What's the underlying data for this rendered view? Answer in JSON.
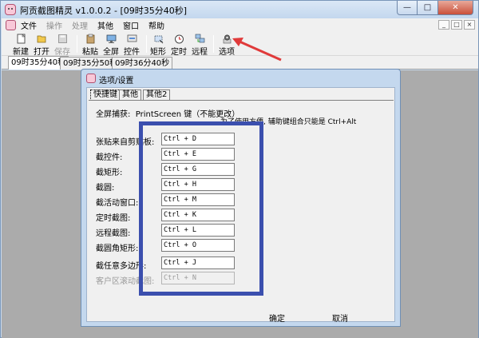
{
  "window": {
    "title": "阿贡截图精灵 v1.0.0.2 - [09时35分40秒]"
  },
  "menu": [
    {
      "label": "文件",
      "disabled": false
    },
    {
      "label": "操作",
      "disabled": true
    },
    {
      "label": "处理",
      "disabled": true
    },
    {
      "label": "其他",
      "disabled": false
    },
    {
      "label": "窗口",
      "disabled": false
    },
    {
      "label": "帮助",
      "disabled": false
    }
  ],
  "toolbar": {
    "new": "新建",
    "open": "打开",
    "save": "保存",
    "paste": "粘贴",
    "fullscreen": "全屏",
    "control": "控件",
    "rect": "矩形",
    "timer": "定时",
    "remote": "远程",
    "options": "选项"
  },
  "tabs": [
    "09时35分40秒",
    "09时35分50秒",
    "09时36分40秒"
  ],
  "dialog": {
    "title": "选项/设置",
    "tabs": [
      "快捷键",
      "其他",
      "其他2"
    ],
    "fullscreen_label": "全屏捕获:",
    "fullscreen_value": "PrintScreen 键（不能更改）",
    "note": "为了使用方便, 辅助键组合只能是 Ctrl+Alt",
    "rows": [
      {
        "label": "张贴来自剪贴板:",
        "value": "Ctrl + D"
      },
      {
        "label": "截控件:",
        "value": "Ctrl + E"
      },
      {
        "label": "截矩形:",
        "value": "Ctrl + G"
      },
      {
        "label": "截圆:",
        "value": "Ctrl + H"
      },
      {
        "label": "截活动窗口:",
        "value": "Ctrl + M"
      },
      {
        "label": "定时截图:",
        "value": "Ctrl + K"
      },
      {
        "label": "远程截图:",
        "value": "Ctrl + L"
      },
      {
        "label": "截圆角矩形:",
        "value": "Ctrl + O"
      },
      {
        "label": "截任意多边形:",
        "value": "Ctrl + J"
      },
      {
        "label": "客户区滚动截图:",
        "value": "Ctrl + N"
      }
    ],
    "ok": "确定",
    "cancel": "取消"
  },
  "colors": {
    "highlight": "#3b4fae",
    "arrow": "#e03a3a"
  }
}
